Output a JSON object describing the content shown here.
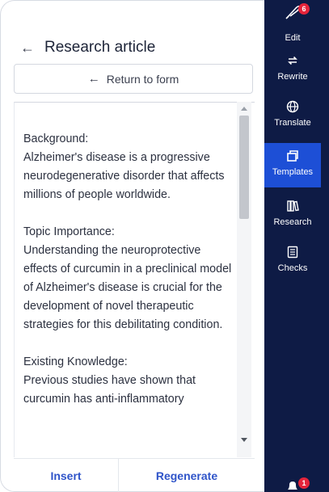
{
  "panel": {
    "title": "Research article",
    "return_label": "Return to form",
    "paragraphs": [
      {
        "heading": "Background:",
        "body": "Alzheimer's disease is a progressive neurodegenerative disorder that affects millions of people worldwide."
      },
      {
        "heading": "Topic Importance:",
        "body": "Understanding the neuroprotective effects of curcumin in a preclinical model of Alzheimer's disease is crucial for the development of novel therapeutic strategies for this debilitating condition."
      },
      {
        "heading": "Existing Knowledge:",
        "body": "Previous studies have shown that curcumin has anti-inflammatory"
      }
    ],
    "insert_label": "Insert",
    "regenerate_label": "Regenerate"
  },
  "rail": {
    "top_badge": "6",
    "bottom_badge": "1",
    "items": [
      {
        "label": "Edit",
        "icon": "edit-icon"
      },
      {
        "label": "Rewrite",
        "icon": "rewrite-icon"
      },
      {
        "label": "Translate",
        "icon": "globe-icon"
      },
      {
        "label": "Templates",
        "icon": "templates-icon",
        "active": true
      },
      {
        "label": "Research",
        "icon": "books-icon"
      },
      {
        "label": "Checks",
        "icon": "checklist-icon"
      }
    ]
  },
  "colors": {
    "rail_bg": "#0e1b45",
    "rail_active": "#1d4fd6",
    "accent": "#2f54c9",
    "badge": "#e5243b"
  }
}
